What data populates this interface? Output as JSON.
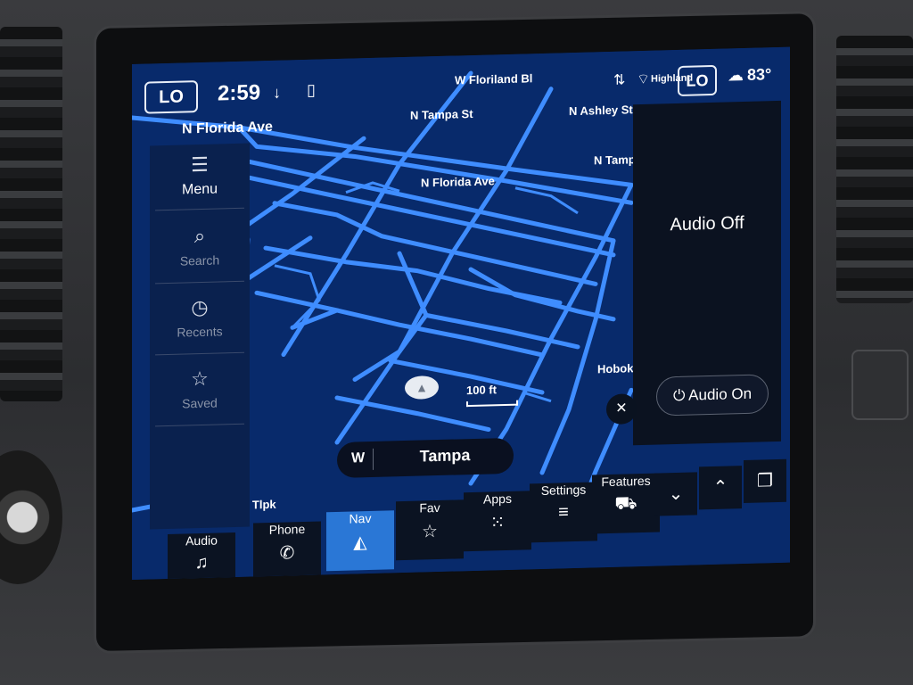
{
  "status_bar": {
    "climate_left": "LO",
    "time": "2:59",
    "climate_right": "LO",
    "outside_temp": "83°"
  },
  "map": {
    "streets": [
      {
        "id": "n-florida-ave-top",
        "label": "N Florida Ave"
      },
      {
        "id": "n-tampa-st-top",
        "label": "N Tampa St"
      },
      {
        "id": "w-floriland",
        "label": "W Floriland Bl"
      },
      {
        "id": "n-ashley-st",
        "label": "N Ashley St"
      },
      {
        "id": "n-tampa-st-right",
        "label": "N Tampa S"
      },
      {
        "id": "n-florida-ave-mid",
        "label": "N Florida Ave"
      },
      {
        "id": "hoboken",
        "label": "Hoboken A"
      },
      {
        "id": "central-ave",
        "label": "Central Ave Tlpk"
      },
      {
        "id": "highland",
        "label": "Highland"
      }
    ],
    "scale_label": "100 ft",
    "heading": "W",
    "destination": "Tampa"
  },
  "sidebar": {
    "items": [
      {
        "label": "Menu",
        "icon": "menu-icon"
      },
      {
        "label": "Search",
        "icon": "search-icon"
      },
      {
        "label": "Recents",
        "icon": "clock-icon"
      },
      {
        "label": "Saved",
        "icon": "star-icon"
      }
    ]
  },
  "audio_panel": {
    "status": "Audio Off",
    "button": "Audio On"
  },
  "bottom_nav": {
    "items": [
      {
        "label": "Audio",
        "icon": "music-note-icon"
      },
      {
        "label": "Phone",
        "icon": "phone-icon"
      },
      {
        "label": "Nav",
        "icon": "navigation-icon",
        "active": true
      },
      {
        "label": "Fav",
        "icon": "star-plus-icon"
      },
      {
        "label": "Apps",
        "icon": "grid-icon"
      },
      {
        "label": "Settings",
        "icon": "sliders-icon"
      },
      {
        "label": "Features",
        "icon": "truck-icon"
      }
    ],
    "controls": [
      {
        "icon": "chevron-down-icon"
      },
      {
        "icon": "chevron-up-icon"
      },
      {
        "icon": "copy-icon"
      }
    ]
  },
  "colors": {
    "map_bg": "#082a6b",
    "road": "#3f8dff",
    "active_tab": "#2a77d6"
  }
}
